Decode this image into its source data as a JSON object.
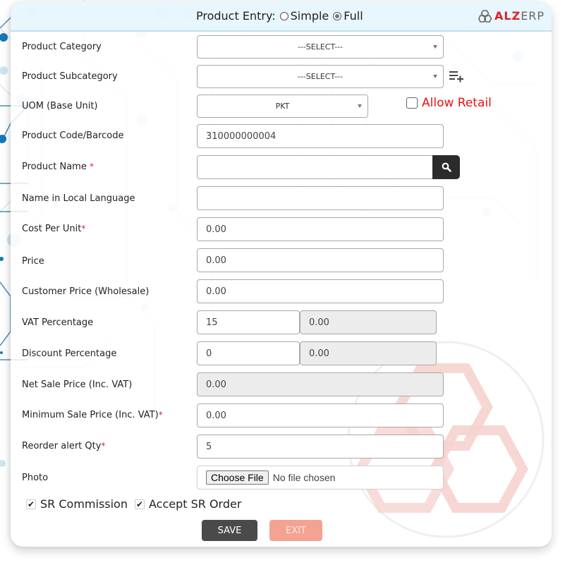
{
  "header": {
    "title": "Product Entry:",
    "modes": [
      {
        "label": "Simple",
        "selected": false
      },
      {
        "label": "Full",
        "selected": true
      }
    ],
    "logo": {
      "brand_red": "ALZ",
      "brand_grey": "ERP"
    }
  },
  "colors": {
    "accent_red": "#e0212b",
    "save_bg": "#4a4a4a",
    "exit_bg": "#f4a292",
    "header_bg": "#e1f3fd"
  },
  "fields": {
    "category": {
      "label": "Product Category",
      "value": "---SELECT---"
    },
    "subcategory": {
      "label": "Product Subcategory",
      "value": "---SELECT---"
    },
    "uom": {
      "label": "UOM (Base Unit)",
      "value": "PKT"
    },
    "allow_retail": {
      "label": "Allow Retail",
      "checked": false
    },
    "code": {
      "label": "Product Code/Barcode",
      "value": "310000000004"
    },
    "name": {
      "label": "Product Name ",
      "required": "*",
      "value": ""
    },
    "local_name": {
      "label": "Name in Local Language",
      "value": ""
    },
    "cost": {
      "label": "Cost Per Unit",
      "required": "*",
      "value": "0.00"
    },
    "price": {
      "label": "Price",
      "value": "0.00"
    },
    "customer_price": {
      "label": "Customer Price (Wholesale)",
      "value": "0.00"
    },
    "vat": {
      "label": "VAT Percentage",
      "value": "15",
      "amount": "0.00"
    },
    "discount": {
      "label": "Discount Percentage",
      "value": "0",
      "amount": "0.00"
    },
    "net_sale": {
      "label": "Net Sale Price (Inc. VAT)",
      "value": "0.00"
    },
    "min_sale": {
      "label": "Minimum Sale Price (Inc. VAT)",
      "required": "*",
      "value": "0.00"
    },
    "reorder": {
      "label": "Reorder alert Qty",
      "required": "*",
      "value": "5"
    },
    "photo": {
      "label": "Photo",
      "button": "Choose File",
      "status": "No file chosen"
    }
  },
  "checks": {
    "sr_commission": {
      "label": "SR Commission",
      "checked": true
    },
    "accept_sr_order": {
      "label": "Accept SR Order",
      "checked": true
    }
  },
  "actions": {
    "save": "SAVE",
    "exit": "EXIT"
  },
  "icons": {
    "search": "search-icon",
    "add_list": "playlist-add-icon",
    "logo": "alzerp-logo-icon",
    "check": "✔"
  }
}
